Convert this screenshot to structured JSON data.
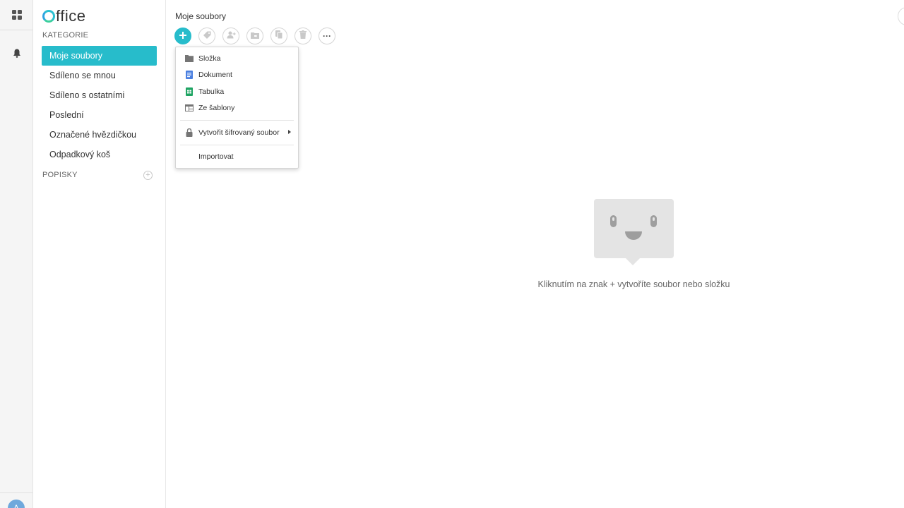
{
  "app": {
    "logo_text": "ffice",
    "accent": "#27bccb"
  },
  "rail": {
    "apps_icon": "apps-grid-icon",
    "notifications_icon": "bell-icon",
    "avatar_letter": "A"
  },
  "sidebar": {
    "categories_title": "KATEGORIE",
    "items": [
      {
        "label": "Moje soubory",
        "active": true
      },
      {
        "label": "Sdíleno se mnou"
      },
      {
        "label": "Sdíleno s ostatními"
      },
      {
        "label": "Poslední"
      },
      {
        "label": "Označené hvězdičkou"
      },
      {
        "label": "Odpadkový koš"
      }
    ],
    "labels_title": "POPISKY",
    "labels_add": "+"
  },
  "main": {
    "breadcrumb": "Moje soubory",
    "toolbar": {
      "new_icon": "plus-icon",
      "tag_icon": "tag-icon",
      "share_icon": "add-person-icon",
      "move_icon": "folder-move-icon",
      "copy_icon": "copy-icon",
      "delete_icon": "trash-icon",
      "more_label": "···"
    },
    "new_menu": {
      "items": [
        {
          "label": "Složka",
          "icon": "folder-icon",
          "color": "#757575"
        },
        {
          "label": "Dokument",
          "icon": "document-icon",
          "color": "#4a7fe0"
        },
        {
          "label": "Tabulka",
          "icon": "spreadsheet-icon",
          "color": "#1fa463"
        },
        {
          "label": "Ze šablony",
          "icon": "template-icon",
          "color": "#757575"
        }
      ],
      "encrypted": {
        "label": "Vytvořit šifrovaný soubor",
        "icon": "lock-icon"
      },
      "import": {
        "label": "Importovat"
      }
    },
    "empty_state": {
      "text": "Kliknutím na znak + vytvoříte soubor nebo složku"
    }
  }
}
